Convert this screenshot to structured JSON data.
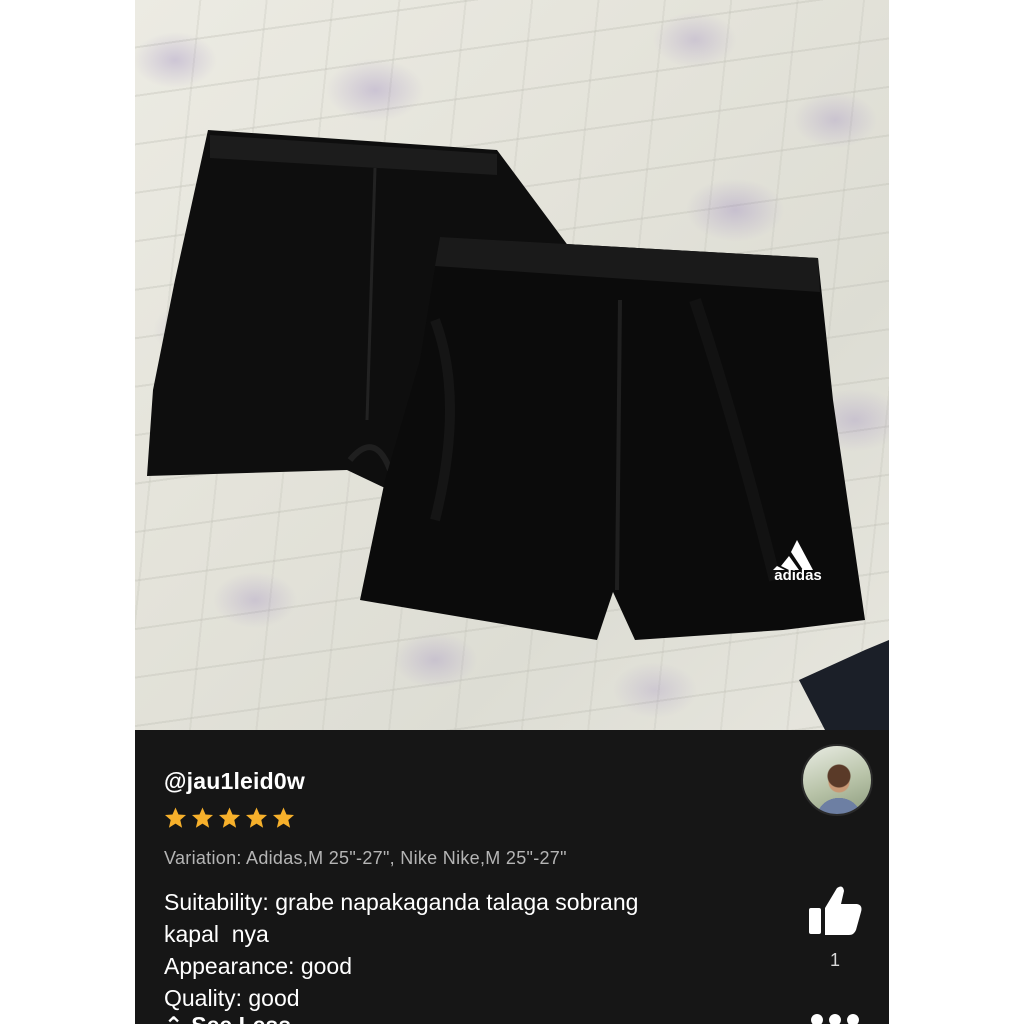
{
  "photo": {
    "alt_subject": "shorts-photo",
    "logo_text": "adidas"
  },
  "review": {
    "username": "@jau1leid0w",
    "rating": 5,
    "rating_max": 5,
    "star_color": "#f6b02b",
    "variation": "Variation: Adidas,M 25\"-27\", Nike Nike,M 25\"-27\"",
    "lines": [
      "Suitability: grabe napakaganda talaga sobrang",
      "kapal  nya",
      "Appearance: good",
      "Quality: good"
    ],
    "see_less_label": "See Less",
    "like_count": "1",
    "like_icon": "thumbs-up-icon",
    "more_icon": "more-dots-icon"
  },
  "colors": {
    "panel_bg": "#161616",
    "text": "#ffffff",
    "muted_text": "#b5b5b5"
  }
}
